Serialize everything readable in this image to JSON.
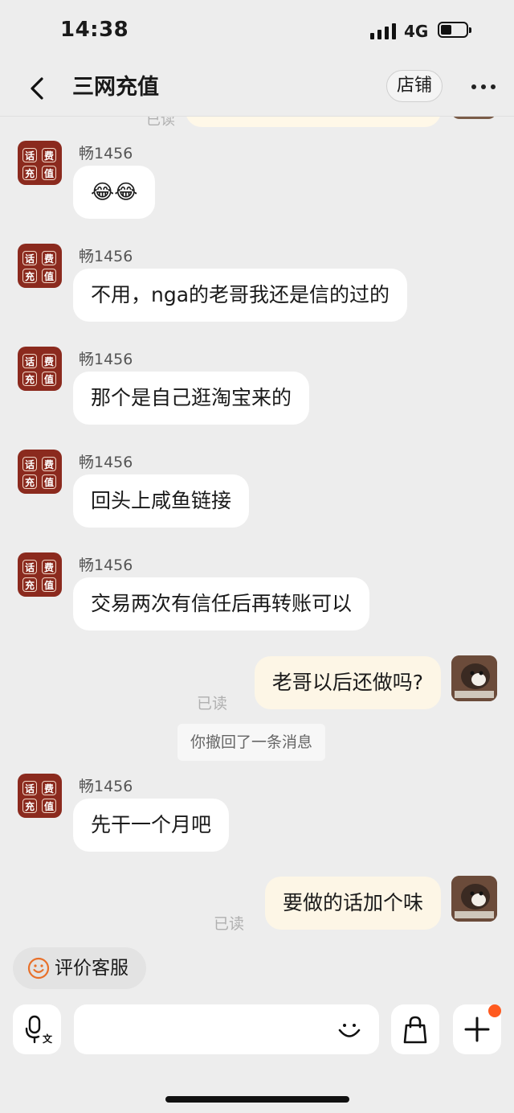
{
  "status_bar": {
    "time": "14:38",
    "network": "4G"
  },
  "header": {
    "title": "三网充值",
    "shop_button": "店铺"
  },
  "partial_top": {
    "read_label": "已读"
  },
  "messages": [
    {
      "direction": "in",
      "sender": "畅1456",
      "text": "😂😂"
    },
    {
      "direction": "in",
      "sender": "畅1456",
      "text": "不用，nga的老哥我还是信的过的"
    },
    {
      "direction": "in",
      "sender": "畅1456",
      "text": "那个是自己逛淘宝来的"
    },
    {
      "direction": "in",
      "sender": "畅1456",
      "text": "回头上咸鱼链接"
    },
    {
      "direction": "in",
      "sender": "畅1456",
      "text": "交易两次有信任后再转账可以"
    },
    {
      "direction": "out",
      "text": "老哥以后还做吗?",
      "read_label": "已读"
    },
    {
      "direction": "system",
      "text": "你撤回了一条消息"
    },
    {
      "direction": "in",
      "sender": "畅1456",
      "text": "先干一个月吧"
    },
    {
      "direction": "out",
      "text": "要做的话加个味",
      "read_label": "已读"
    }
  ],
  "avatar_chars": [
    "话",
    "费",
    "充",
    "值"
  ],
  "rate_button": {
    "label": "评价客服"
  },
  "icons": {
    "back": "chevron-left-icon",
    "more": "more-dots-icon",
    "voice": "voice-translate-icon",
    "emoji": "smile-icon",
    "shopping": "shopping-bag-icon",
    "plus": "plus-icon"
  },
  "colors": {
    "background": "#ededed",
    "incoming_bubble": "#ffffff",
    "outgoing_bubble": "#fdf6e6",
    "avatar_red": "#8b2a1e",
    "rate_icon": "#e8702a",
    "badge": "#ff5a1f"
  }
}
